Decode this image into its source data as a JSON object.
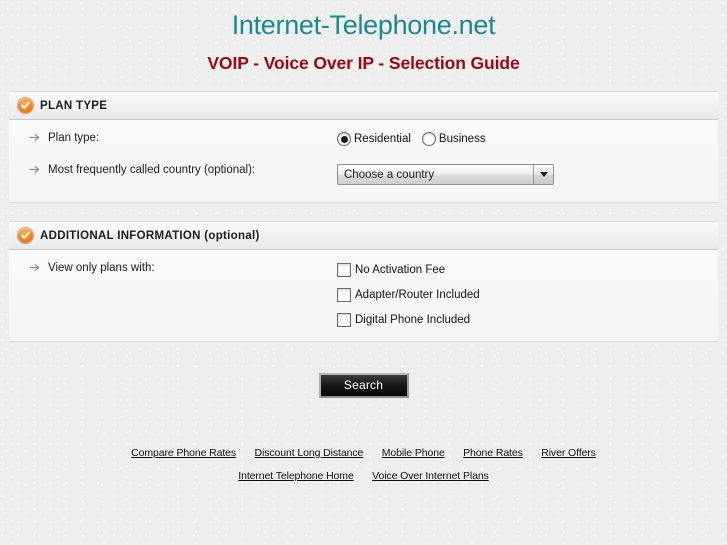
{
  "header": {
    "site_title": "Internet-Telephone.net",
    "page_subtitle": "VOIP - Voice Over IP - Selection Guide",
    "title_color": "#1b8a8f",
    "subtitle_color": "#9c0812"
  },
  "sections": {
    "plan_type": {
      "header_title": "PLAN TYPE",
      "badge_icon": "orange-check-badge-icon",
      "badge_color": "#f58220",
      "plan_type_row": {
        "label": "Plan type:",
        "bullet_icon": "arrow-right-icon",
        "options": [
          {
            "label": "Residential",
            "checked": true
          },
          {
            "label": "Business",
            "checked": false
          }
        ]
      },
      "country_row": {
        "label": "Most frequently called country (optional):",
        "bullet_icon": "arrow-right-icon",
        "select_value": "Choose a country",
        "dropdown_icon": "chevron-down-icon"
      }
    },
    "additional_information": {
      "header_title": "ADDITIONAL INFORMATION (optional)",
      "badge_icon": "orange-check-badge-icon",
      "badge_color": "#f58220",
      "filters_row": {
        "label": "View only plans with:",
        "bullet_icon": "arrow-right-icon",
        "checkboxes": [
          {
            "label": "No Activation Fee",
            "checked": false
          },
          {
            "label": "Adapter/Router Included",
            "checked": false
          },
          {
            "label": "Digital Phone Included",
            "checked": false
          }
        ]
      }
    }
  },
  "actions": {
    "search_label": "Search"
  },
  "footer": {
    "row1": [
      "Compare Phone Rates",
      "Discount Long Distance",
      "Mobile Phone",
      "Phone Rates",
      "River Offers"
    ],
    "row2": [
      "Internet Telephone Home",
      "Voice Over Internet Plans"
    ]
  }
}
